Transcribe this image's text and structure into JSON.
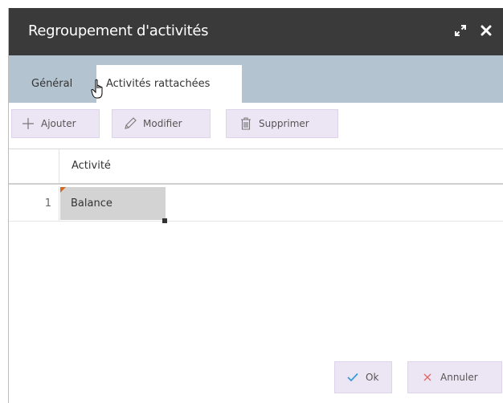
{
  "dialog": {
    "title": "Regroupement d'activités",
    "controls": {
      "expand_icon": "expand-icon",
      "close_icon": "close-icon"
    }
  },
  "tabs": [
    {
      "label": "Général",
      "active": false
    },
    {
      "label": "Activités rattachées",
      "active": true
    }
  ],
  "toolbar": {
    "add_label": "Ajouter",
    "edit_label": "Modifier",
    "delete_label": "Supprimer"
  },
  "grid": {
    "columns": [
      "Activité"
    ],
    "rows": [
      {
        "index": "1",
        "activity": "Balance"
      }
    ]
  },
  "footer": {
    "ok_label": "Ok",
    "cancel_label": "Annuler"
  },
  "colors": {
    "titlebar": "#3a3a3a",
    "tabbar": "#b4c3d0",
    "button_bg": "#ece6f4",
    "ok_check": "#3a9bd5",
    "cancel_x": "#e06666",
    "cell_marker": "#d2691e"
  }
}
